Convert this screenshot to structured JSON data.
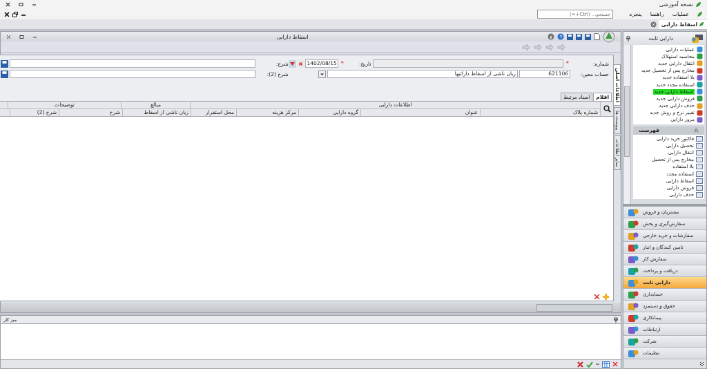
{
  "app": {
    "title": "نسخه آموزشی"
  },
  "menu": [
    {
      "label": "عملیات"
    },
    {
      "label": "راهنما"
    },
    {
      "label": "پنجره"
    }
  ],
  "search": {
    "placeholder": "جستجو... (Ctrl+=)"
  },
  "doc_tabs": [
    {
      "label": "اسقاط دارایی",
      "selected": true
    }
  ],
  "document": {
    "title": "اسقاط دارایی",
    "number": {
      "label": "شماره:",
      "required_mark": "*"
    },
    "date": {
      "label": "تاریخ:",
      "required_mark": "*",
      "value": "1402/08/15"
    },
    "account": {
      "label": "حساب معین:",
      "code": "621106",
      "name": "زیان ناشی از اسقاط دارائیها"
    },
    "description": {
      "label": "شرح:"
    },
    "description_2": {
      "label": "شرح (2):"
    },
    "side_tabs": [
      {
        "label": "اطلاعات اصلی",
        "selected": true
      },
      {
        "label": "پیوست ها",
        "selected": false
      },
      {
        "label": "سایر اطلاعات",
        "selected": false
      }
    ],
    "grid_tabs": [
      {
        "label": "اقلام",
        "selected": true
      },
      {
        "label": "اسناد مرتبط",
        "selected": false
      }
    ],
    "column_groups": [
      {
        "label": "اطلاعات دارایی",
        "columns": [
          "شماره پلاک",
          "عنوان",
          "گروه دارایی",
          "مرکز هزینه",
          "محل استقرار"
        ]
      },
      {
        "label": "مبالغ",
        "columns": [
          "زیان ناشی از اسقاط"
        ]
      },
      {
        "label": "توضیحات",
        "columns": [
          "شرح",
          "شرح (2)"
        ]
      }
    ]
  },
  "workspace": {
    "title": "میز کار"
  },
  "sidebar": {
    "title": "دارایی ثابت",
    "actions": [
      {
        "label": "عملیات دارایی",
        "selected": false
      },
      {
        "label": "محاسبه استهلاک",
        "selected": false
      },
      {
        "label": "انتقال دارایی جدید",
        "selected": false
      },
      {
        "label": "مخارج پس از تحصیل جدید",
        "selected": false
      },
      {
        "label": "بلا استفاده جدید",
        "selected": false
      },
      {
        "label": "استفاده مجدد جدید",
        "selected": false
      },
      {
        "label": "اسقاط دارایی جدید",
        "selected": true
      },
      {
        "label": "فروش دارایی جدید",
        "selected": false
      },
      {
        "label": "حذف دارایی جدید",
        "selected": false
      },
      {
        "label": "تغییر نرخ و روش جدید",
        "selected": false
      },
      {
        "label": "مرور دارایی",
        "selected": false
      }
    ],
    "list_title": "فهرست",
    "lists": [
      {
        "label": "فاکتور خرید دارایی"
      },
      {
        "label": "تحصیل دارایی"
      },
      {
        "label": "انتقال دارایی"
      },
      {
        "label": "مخارج پس از تحصیل"
      },
      {
        "label": "بلا استفاده"
      },
      {
        "label": "استفاده مجدد"
      },
      {
        "label": "اسقاط دارایی"
      },
      {
        "label": "فروش دارایی"
      },
      {
        "label": "حذف دارایی"
      }
    ],
    "modules": [
      {
        "label": "مشتریان و فروش",
        "selected": false
      },
      {
        "label": "سفارش‌گیری و پخش",
        "selected": false
      },
      {
        "label": "سفارشات و خرید خارجی",
        "selected": false
      },
      {
        "label": "تامین کنندگان و انبار",
        "selected": false
      },
      {
        "label": "سفارش کار",
        "selected": false
      },
      {
        "label": "دریافت و پرداخت",
        "selected": false
      },
      {
        "label": "دارایی ثابت",
        "selected": true
      },
      {
        "label": "حسابداری",
        "selected": false
      },
      {
        "label": "حقوق و دستمزد",
        "selected": false
      },
      {
        "label": "پیمانکاری",
        "selected": false
      },
      {
        "label": "ارتباطات",
        "selected": false
      },
      {
        "label": "شرکت",
        "selected": false
      },
      {
        "label": "تنظیمات",
        "selected": false
      }
    ]
  }
}
